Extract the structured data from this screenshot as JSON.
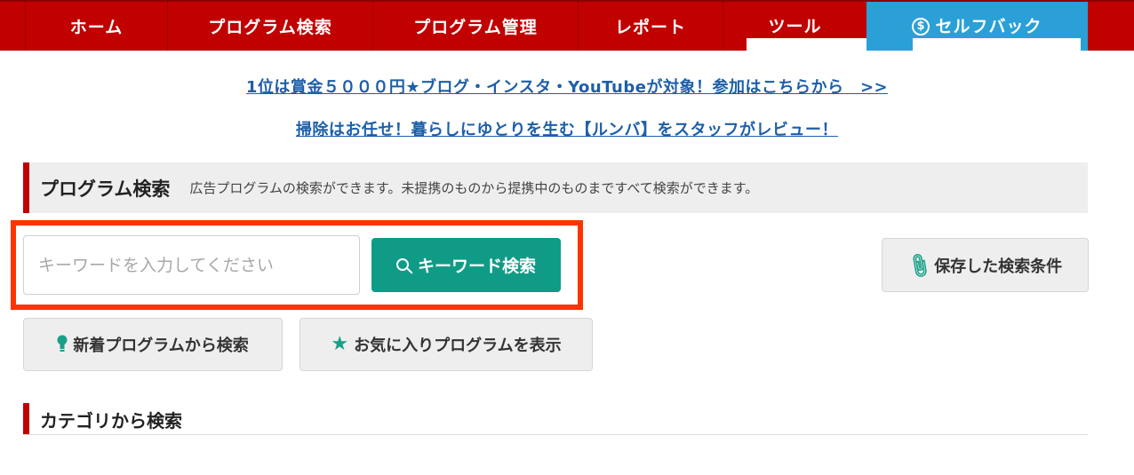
{
  "nav": {
    "items": [
      {
        "label": "ホーム"
      },
      {
        "label": "プログラム検索"
      },
      {
        "label": "プログラム管理"
      },
      {
        "label": "レポート"
      },
      {
        "label": "ツール"
      },
      {
        "label": "セルフバック"
      }
    ],
    "self_icon_glyph": "$",
    "accent_color": "#c10000",
    "self_back_color": "#2aa0d6"
  },
  "banners": {
    "link1": "1位は賞金５０００円★ブログ・インスタ・YouTubeが対象！参加はこちらから　>>",
    "link2": "掃除はお任せ！暮らしにゆとりを生む【ルンバ】をスタッフがレビュー！"
  },
  "program_search": {
    "title": "プログラム検索",
    "description": "広告プログラムの検索ができます。未提携のものから提携中のものまですべて検索ができます。",
    "input_placeholder": "キーワードを入力してください",
    "search_button": "キーワード検索",
    "saved_conditions_button": "保存した検索条件",
    "new_programs_button": "新着プログラムから検索",
    "favorites_button": "お気に入りプログラムを表示",
    "button_color": "#109b86"
  },
  "category": {
    "title": "カテゴリから検索"
  }
}
